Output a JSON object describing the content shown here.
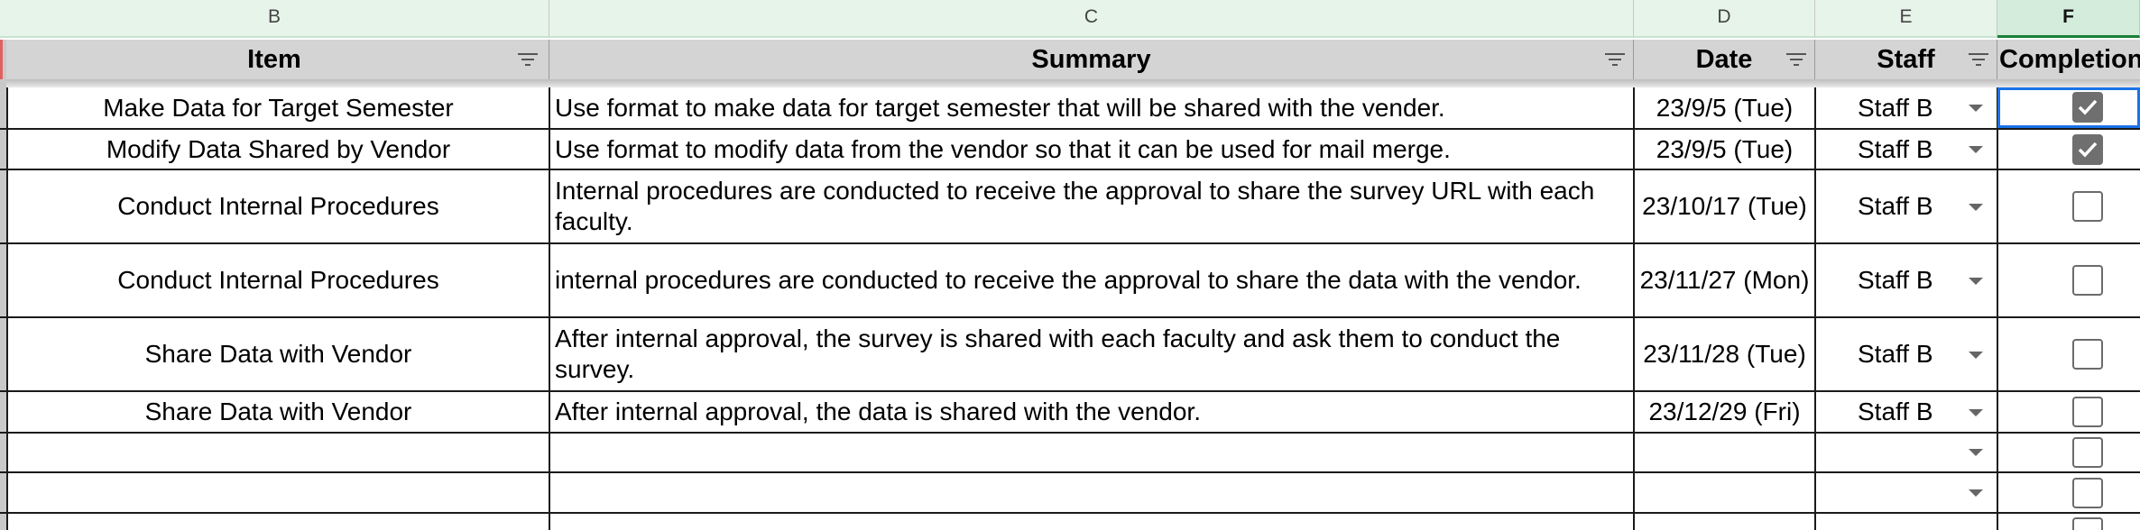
{
  "columns": {
    "letters": [
      "B",
      "C",
      "D",
      "E",
      "F"
    ],
    "headers": [
      "Item",
      "Summary",
      "Date",
      "Staff",
      "Completion"
    ]
  },
  "rows": [
    {
      "item": "Make Data for Target Semester",
      "summary": "Use format to make data for target semester that will be shared with the vender.",
      "date": "23/9/5 (Tue)",
      "staff": "Staff B",
      "completed": true
    },
    {
      "item": "Modify Data Shared by Vendor",
      "summary": "Use format to modify data from the vendor so that it can be used for mail merge.",
      "date": "23/9/5 (Tue)",
      "staff": "Staff B",
      "completed": true
    },
    {
      "item": "Conduct Internal Procedures",
      "summary": "Internal procedures are conducted to receive the approval to share the survey URL with each faculty.",
      "date": "23/10/17 (Tue)",
      "staff": "Staff B",
      "completed": false
    },
    {
      "item": "Conduct Internal Procedures",
      "summary": "internal procedures are conducted to receive the approval to share the data with the vendor.",
      "date": "23/11/27 (Mon)",
      "staff": "Staff B",
      "completed": false
    },
    {
      "item": "Share Data with Vendor",
      "summary": "After internal approval, the survey is shared with each faculty and ask them to conduct the survey.",
      "date": "23/11/28 (Tue)",
      "staff": "Staff B",
      "completed": false
    },
    {
      "item": "Share Data with Vendor",
      "summary": "After internal approval, the data is shared with the vendor.",
      "date": "23/12/29 (Fri)",
      "staff": "Staff B",
      "completed": false
    },
    {
      "item": "",
      "summary": "",
      "date": "",
      "staff": "",
      "completed": false
    },
    {
      "item": "",
      "summary": "",
      "date": "",
      "staff": "",
      "completed": false
    },
    {
      "item": "",
      "summary": "",
      "date": "",
      "staff": "",
      "completed": false
    }
  ],
  "colors": {
    "column_header_bg": "#e6f4ea",
    "header_row_bg": "#d4d4d4",
    "active_cell_border": "#1a73e8",
    "checked_fill": "#6f6f6f"
  }
}
